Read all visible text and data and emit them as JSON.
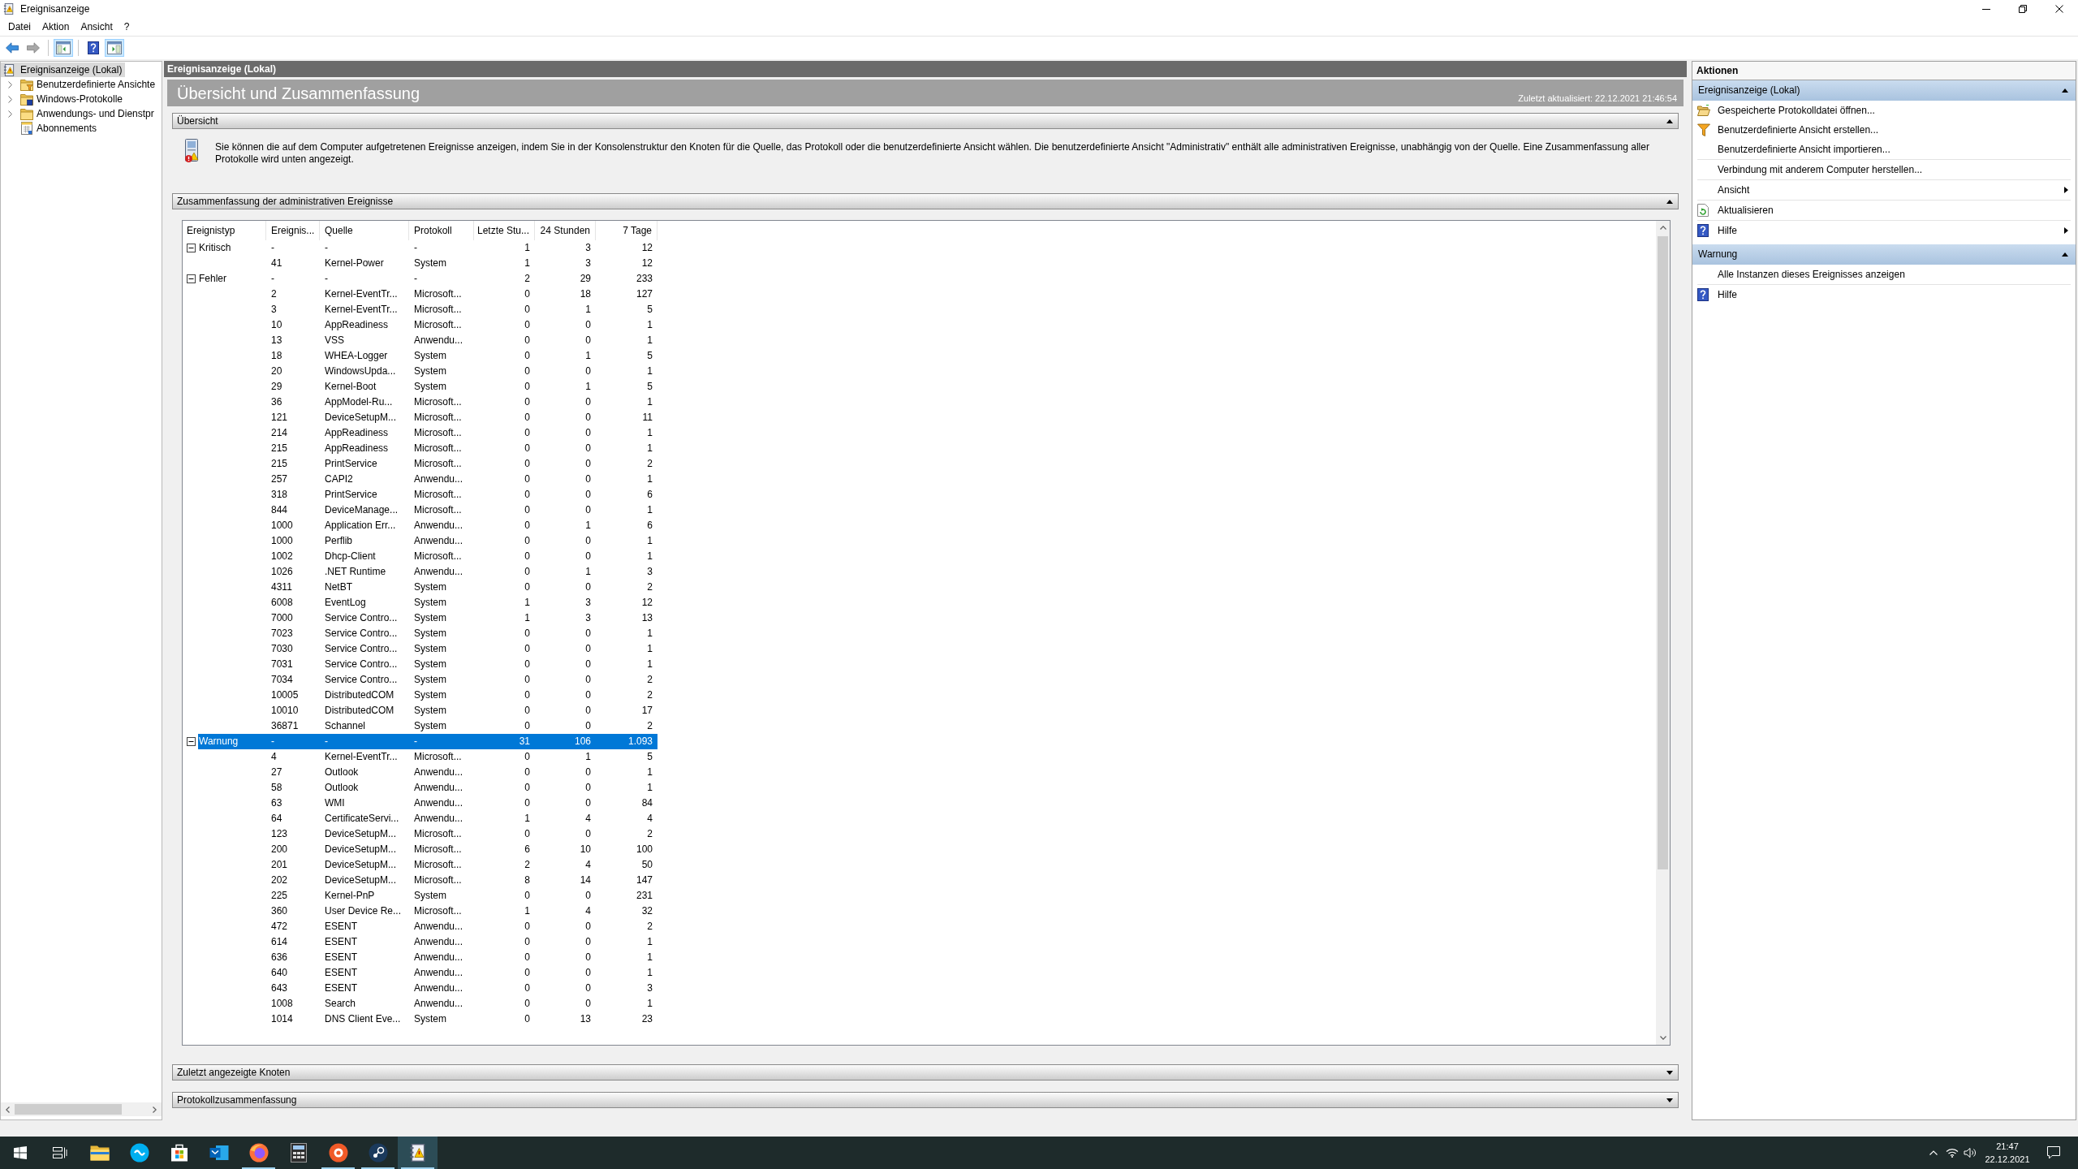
{
  "window": {
    "title": "Ereignisanzeige"
  },
  "menu": [
    "Datei",
    "Aktion",
    "Ansicht",
    "?"
  ],
  "toolbar": [
    [
      {
        "kind": "back",
        "disabled": false,
        "pressed": false
      },
      {
        "kind": "forward",
        "disabled": true,
        "pressed": false
      }
    ],
    [
      {
        "kind": "tree",
        "disabled": false,
        "pressed": true
      }
    ],
    [
      {
        "kind": "help",
        "disabled": false,
        "pressed": false
      },
      {
        "kind": "pane",
        "disabled": false,
        "pressed": true
      }
    ]
  ],
  "tree": [
    {
      "label": "Ereignisanzeige (Lokal)",
      "kind": "viewer",
      "selected": true,
      "expanded": true,
      "children": [
        {
          "label": "Benutzerdefinierte Ansichte",
          "kind": "filter",
          "selected": false,
          "expandable": true
        },
        {
          "label": "Windows-Protokolle",
          "kind": "logs",
          "selected": false,
          "expandable": true
        },
        {
          "label": "Anwendungs- und Dienstpr",
          "kind": "folder",
          "selected": false,
          "expandable": true
        },
        {
          "label": "Abonnements",
          "kind": "subscriptions",
          "selected": false,
          "expandable": false
        }
      ]
    }
  ],
  "console": {
    "header": "Ereignisanzeige (Lokal)",
    "title": "Übersicht und Zusammenfassung",
    "updated": "Zuletzt aktualisiert: 22.12.2021 21:46:54",
    "sections": [
      {
        "kind": "text",
        "title": "Übersicht",
        "expanded": true,
        "text": "Sie können die auf dem Computer aufgetretenen Ereignisse anzeigen, indem Sie in der Konsolenstruktur den Knoten für die Quelle, das Protokoll oder die benutzerdefinierte Ansicht wählen. Die benutzerdefinierte Ansicht \"Administrativ\" enthält alle administrativen Ereignisse, unabhängig von der Quelle. Eine Zusammenfassung aller Protokolle wird unten angezeigt."
      },
      {
        "kind": "table",
        "title": "Zusammenfassung der administrativen Ereignisse",
        "expanded": true,
        "table": {
          "columns": [
            "Ereignistyp",
            "Ereignis...",
            "Quelle",
            "Protokoll",
            "Letzte Stu...",
            "24 Stunden",
            "7 Tage"
          ],
          "groups": [
            {
              "type": "Kritisch",
              "expanded": true,
              "selected": false,
              "cells": [
                "-",
                "-",
                "-",
                "1",
                "3",
                "12"
              ],
              "rows": [
                {
                  "selected": false,
                  "cells": [
                    "41",
                    "Kernel-Power",
                    "System",
                    "1",
                    "3",
                    "12"
                  ]
                }
              ]
            },
            {
              "type": "Fehler",
              "expanded": true,
              "selected": false,
              "cells": [
                "-",
                "-",
                "-",
                "2",
                "29",
                "233"
              ],
              "rows": [
                {
                  "selected": false,
                  "cells": [
                    "2",
                    "Kernel-EventTr...",
                    "Microsoft...",
                    "0",
                    "18",
                    "127"
                  ]
                },
                {
                  "selected": false,
                  "cells": [
                    "3",
                    "Kernel-EventTr...",
                    "Microsoft...",
                    "0",
                    "1",
                    "5"
                  ]
                },
                {
                  "selected": false,
                  "cells": [
                    "10",
                    "AppReadiness",
                    "Microsoft...",
                    "0",
                    "0",
                    "1"
                  ]
                },
                {
                  "selected": false,
                  "cells": [
                    "13",
                    "VSS",
                    "Anwendu...",
                    "0",
                    "0",
                    "1"
                  ]
                },
                {
                  "selected": false,
                  "cells": [
                    "18",
                    "WHEA-Logger",
                    "System",
                    "0",
                    "1",
                    "5"
                  ]
                },
                {
                  "selected": false,
                  "cells": [
                    "20",
                    "WindowsUpda...",
                    "System",
                    "0",
                    "0",
                    "1"
                  ]
                },
                {
                  "selected": false,
                  "cells": [
                    "29",
                    "Kernel-Boot",
                    "System",
                    "0",
                    "1",
                    "5"
                  ]
                },
                {
                  "selected": false,
                  "cells": [
                    "36",
                    "AppModel-Ru...",
                    "Microsoft...",
                    "0",
                    "0",
                    "1"
                  ]
                },
                {
                  "selected": false,
                  "cells": [
                    "121",
                    "DeviceSetupM...",
                    "Microsoft...",
                    "0",
                    "0",
                    "11"
                  ]
                },
                {
                  "selected": false,
                  "cells": [
                    "214",
                    "AppReadiness",
                    "Microsoft...",
                    "0",
                    "0",
                    "1"
                  ]
                },
                {
                  "selected": false,
                  "cells": [
                    "215",
                    "AppReadiness",
                    "Microsoft...",
                    "0",
                    "0",
                    "1"
                  ]
                },
                {
                  "selected": false,
                  "cells": [
                    "215",
                    "PrintService",
                    "Microsoft...",
                    "0",
                    "0",
                    "2"
                  ]
                },
                {
                  "selected": false,
                  "cells": [
                    "257",
                    "CAPI2",
                    "Anwendu...",
                    "0",
                    "0",
                    "1"
                  ]
                },
                {
                  "selected": false,
                  "cells": [
                    "318",
                    "PrintService",
                    "Microsoft...",
                    "0",
                    "0",
                    "6"
                  ]
                },
                {
                  "selected": false,
                  "cells": [
                    "844",
                    "DeviceManage...",
                    "Microsoft...",
                    "0",
                    "0",
                    "1"
                  ]
                },
                {
                  "selected": false,
                  "cells": [
                    "1000",
                    "Application Err...",
                    "Anwendu...",
                    "0",
                    "1",
                    "6"
                  ]
                },
                {
                  "selected": false,
                  "cells": [
                    "1000",
                    "Perflib",
                    "Anwendu...",
                    "0",
                    "0",
                    "1"
                  ]
                },
                {
                  "selected": false,
                  "cells": [
                    "1002",
                    "Dhcp-Client",
                    "Microsoft...",
                    "0",
                    "0",
                    "1"
                  ]
                },
                {
                  "selected": false,
                  "cells": [
                    "1026",
                    ".NET Runtime",
                    "Anwendu...",
                    "0",
                    "1",
                    "3"
                  ]
                },
                {
                  "selected": false,
                  "cells": [
                    "4311",
                    "NetBT",
                    "System",
                    "0",
                    "0",
                    "2"
                  ]
                },
                {
                  "selected": false,
                  "cells": [
                    "6008",
                    "EventLog",
                    "System",
                    "1",
                    "3",
                    "12"
                  ]
                },
                {
                  "selected": false,
                  "cells": [
                    "7000",
                    "Service Contro...",
                    "System",
                    "1",
                    "3",
                    "13"
                  ]
                },
                {
                  "selected": false,
                  "cells": [
                    "7023",
                    "Service Contro...",
                    "System",
                    "0",
                    "0",
                    "1"
                  ]
                },
                {
                  "selected": false,
                  "cells": [
                    "7030",
                    "Service Contro...",
                    "System",
                    "0",
                    "0",
                    "1"
                  ]
                },
                {
                  "selected": false,
                  "cells": [
                    "7031",
                    "Service Contro...",
                    "System",
                    "0",
                    "0",
                    "1"
                  ]
                },
                {
                  "selected": false,
                  "cells": [
                    "7034",
                    "Service Contro...",
                    "System",
                    "0",
                    "0",
                    "2"
                  ]
                },
                {
                  "selected": false,
                  "cells": [
                    "10005",
                    "DistributedCOM",
                    "System",
                    "0",
                    "0",
                    "2"
                  ]
                },
                {
                  "selected": false,
                  "cells": [
                    "10010",
                    "DistributedCOM",
                    "System",
                    "0",
                    "0",
                    "17"
                  ]
                },
                {
                  "selected": false,
                  "cells": [
                    "36871",
                    "Schannel",
                    "System",
                    "0",
                    "0",
                    "2"
                  ]
                }
              ]
            },
            {
              "type": "Warnung",
              "expanded": true,
              "selected": true,
              "cells": [
                "-",
                "-",
                "-",
                "31",
                "106",
                "1.093"
              ],
              "rows": [
                {
                  "selected": false,
                  "cells": [
                    "4",
                    "Kernel-EventTr...",
                    "Microsoft...",
                    "0",
                    "1",
                    "5"
                  ]
                },
                {
                  "selected": false,
                  "cells": [
                    "27",
                    "Outlook",
                    "Anwendu...",
                    "0",
                    "0",
                    "1"
                  ]
                },
                {
                  "selected": false,
                  "cells": [
                    "58",
                    "Outlook",
                    "Anwendu...",
                    "0",
                    "0",
                    "1"
                  ]
                },
                {
                  "selected": false,
                  "cells": [
                    "63",
                    "WMI",
                    "Anwendu...",
                    "0",
                    "0",
                    "84"
                  ]
                },
                {
                  "selected": false,
                  "cells": [
                    "64",
                    "CertificateServi...",
                    "Anwendu...",
                    "1",
                    "4",
                    "4"
                  ]
                },
                {
                  "selected": false,
                  "cells": [
                    "123",
                    "DeviceSetupM...",
                    "Microsoft...",
                    "0",
                    "0",
                    "2"
                  ]
                },
                {
                  "selected": false,
                  "cells": [
                    "200",
                    "DeviceSetupM...",
                    "Microsoft...",
                    "6",
                    "10",
                    "100"
                  ]
                },
                {
                  "selected": false,
                  "cells": [
                    "201",
                    "DeviceSetupM...",
                    "Microsoft...",
                    "2",
                    "4",
                    "50"
                  ]
                },
                {
                  "selected": false,
                  "cells": [
                    "202",
                    "DeviceSetupM...",
                    "Microsoft...",
                    "8",
                    "14",
                    "147"
                  ]
                },
                {
                  "selected": false,
                  "cells": [
                    "225",
                    "Kernel-PnP",
                    "System",
                    "0",
                    "0",
                    "231"
                  ]
                },
                {
                  "selected": false,
                  "cells": [
                    "360",
                    "User Device Re...",
                    "Microsoft...",
                    "1",
                    "4",
                    "32"
                  ]
                },
                {
                  "selected": false,
                  "cells": [
                    "472",
                    "ESENT",
                    "Anwendu...",
                    "0",
                    "0",
                    "2"
                  ]
                },
                {
                  "selected": false,
                  "cells": [
                    "614",
                    "ESENT",
                    "Anwendu...",
                    "0",
                    "0",
                    "1"
                  ]
                },
                {
                  "selected": false,
                  "cells": [
                    "636",
                    "ESENT",
                    "Anwendu...",
                    "0",
                    "0",
                    "1"
                  ]
                },
                {
                  "selected": false,
                  "cells": [
                    "640",
                    "ESENT",
                    "Anwendu...",
                    "0",
                    "0",
                    "1"
                  ]
                },
                {
                  "selected": false,
                  "cells": [
                    "643",
                    "ESENT",
                    "Anwendu...",
                    "0",
                    "0",
                    "3"
                  ]
                },
                {
                  "selected": false,
                  "cells": [
                    "1008",
                    "Search",
                    "Anwendu...",
                    "0",
                    "0",
                    "1"
                  ]
                },
                {
                  "selected": false,
                  "cells": [
                    "1014",
                    "DNS Client Eve...",
                    "System",
                    "0",
                    "13",
                    "23"
                  ]
                }
              ]
            }
          ]
        }
      },
      {
        "kind": "collapsed",
        "title": "Zuletzt angezeigte Knoten",
        "expanded": false
      },
      {
        "kind": "collapsed",
        "title": "Protokollzusammenfassung",
        "expanded": false
      }
    ]
  },
  "actions": {
    "title": "Aktionen",
    "groups": [
      {
        "title": "Ereignisanzeige (Lokal)",
        "expanded": true,
        "items": [
          {
            "label": "Gespeicherte Protokolldatei öffnen...",
            "kind": "open",
            "submenu": false,
            "divider_above": false
          },
          {
            "label": "Benutzerdefinierte Ansicht erstellen...",
            "kind": "filter",
            "submenu": false,
            "divider_above": false
          },
          {
            "label": "Benutzerdefinierte Ansicht importieren...",
            "kind": "plain",
            "submenu": false,
            "divider_above": false
          },
          {
            "label": "Verbindung mit anderem Computer herstellen...",
            "kind": "plain",
            "submenu": false,
            "divider_above": true
          },
          {
            "label": "Ansicht",
            "kind": "plain",
            "submenu": true,
            "divider_above": true
          },
          {
            "label": "Aktualisieren",
            "kind": "refresh",
            "submenu": false,
            "divider_above": true
          },
          {
            "label": "Hilfe",
            "kind": "help",
            "submenu": true,
            "divider_above": true
          }
        ]
      },
      {
        "title": "Warnung",
        "expanded": true,
        "items": [
          {
            "label": "Alle Instanzen dieses Ereignisses anzeigen",
            "kind": "plain",
            "submenu": false,
            "divider_above": false
          },
          {
            "label": "Hilfe",
            "kind": "help",
            "submenu": false,
            "divider_above": true
          }
        ]
      }
    ]
  },
  "taskbar": {
    "buttons": [
      {
        "kind": "start",
        "active": false,
        "running": false
      },
      {
        "kind": "taskview",
        "active": false,
        "running": false
      },
      {
        "kind": "explorer",
        "active": false,
        "running": false
      },
      {
        "kind": "chat",
        "active": false,
        "running": false
      },
      {
        "kind": "store",
        "active": false,
        "running": false
      },
      {
        "kind": "mail",
        "active": false,
        "running": false
      },
      {
        "kind": "browser",
        "active": false,
        "running": true
      },
      {
        "kind": "grid",
        "active": false,
        "running": false
      },
      {
        "kind": "ring",
        "active": false,
        "running": true
      },
      {
        "kind": "game",
        "active": false,
        "running": true
      },
      {
        "kind": "eventviewer",
        "active": true,
        "running": true
      }
    ],
    "time": "21:47",
    "date": "22.12.2021"
  }
}
